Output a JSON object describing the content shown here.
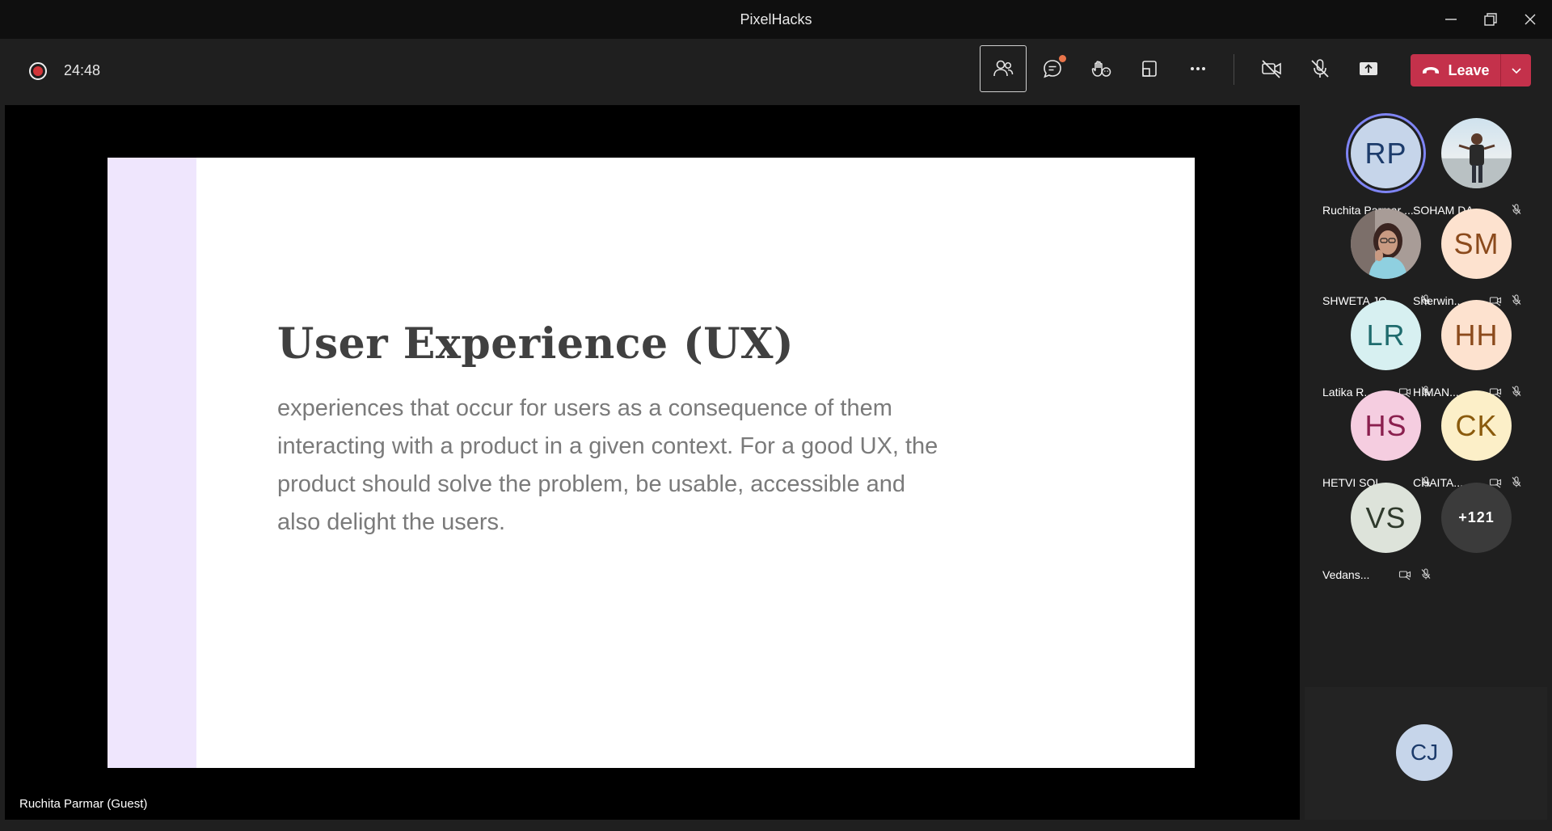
{
  "window": {
    "title": "PixelHacks",
    "minimize_icon": "minimize-icon",
    "restore_icon": "restore-icon",
    "close_icon": "close-icon"
  },
  "toolbar": {
    "recording_icon": "record-icon",
    "timer": "24:48",
    "buttons": [
      {
        "name": "participants",
        "icon": "people-icon",
        "active": true
      },
      {
        "name": "chat",
        "icon": "chat-icon",
        "has_badge": true
      },
      {
        "name": "reactions",
        "icon": "raise-hand-icon"
      },
      {
        "name": "rooms",
        "icon": "rooms-icon"
      },
      {
        "name": "more-actions",
        "icon": "ellipsis-icon"
      },
      {
        "name": "camera",
        "icon": "camera-off-icon"
      },
      {
        "name": "mic",
        "icon": "mic-off-icon"
      },
      {
        "name": "share",
        "icon": "share-screen-icon"
      }
    ],
    "leave_label": "Leave",
    "leave_color": "#c4314b"
  },
  "stage": {
    "slide_title": "User Experience (UX)",
    "slide_body": "experiences that occur for users as a consequence of them interacting with a product in a given context. For a good UX, the product should solve the problem, be usable, accessible and also delight the users.",
    "presenter_label": "Ruchita Parmar (Guest)",
    "accent_bar_color": "#efe6fd"
  },
  "participants": [
    {
      "initials": "RP",
      "name": "Ruchita Parmar ...",
      "bg": "#c6d5ea",
      "fg": "#1c3b6b",
      "speaking": true,
      "video_off": false,
      "muted": false
    },
    {
      "initials": "",
      "name": "SOHAM DA...",
      "photo": true,
      "muted": true,
      "video_off": false
    },
    {
      "initials": "",
      "name": "SHWETA JO...",
      "photo": true,
      "muted": true,
      "video_off": false
    },
    {
      "initials": "SM",
      "name": "Sherwin...",
      "bg": "#fde2cf",
      "fg": "#8b4a1c",
      "video_off": true,
      "muted": true
    },
    {
      "initials": "LR",
      "name": "Latika R...",
      "bg": "#d7f0f1",
      "fg": "#1e6b6d",
      "video_off": true,
      "muted": true
    },
    {
      "initials": "HH",
      "name": "HIMAN...",
      "bg": "#fde2cf",
      "fg": "#8b4a1c",
      "video_off": true,
      "muted": true
    },
    {
      "initials": "HS",
      "name": "HETVI SOL...",
      "bg": "#f5cde0",
      "fg": "#8a1f4e",
      "video_off": false,
      "muted": true
    },
    {
      "initials": "CK",
      "name": "CHAITA...",
      "bg": "#fcefc8",
      "fg": "#8a5a0c",
      "video_off": true,
      "muted": true
    },
    {
      "initials": "VS",
      "name": "Vedans...",
      "bg": "#dde3da",
      "fg": "#2f3a2c",
      "video_off": true,
      "muted": true
    }
  ],
  "overflow_count": "+121",
  "featured_participant": {
    "initials": "CJ"
  }
}
